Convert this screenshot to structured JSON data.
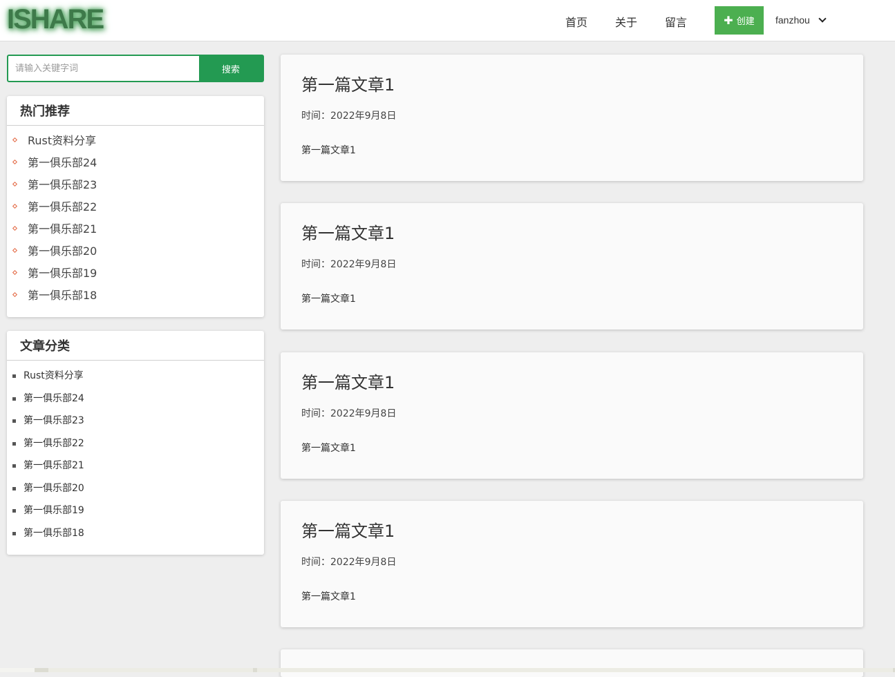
{
  "header": {
    "logo": "ISHARE",
    "nav": [
      "首页",
      "关于",
      "留言"
    ],
    "create_label": "创建",
    "username": "fanzhou"
  },
  "search": {
    "placeholder": "请输入关键字词",
    "button_label": "搜索"
  },
  "hot": {
    "title": "热门推荐",
    "items": [
      "Rust资料分享",
      "第一俱乐部24",
      "第一俱乐部23",
      "第一俱乐部22",
      "第一俱乐部21",
      "第一俱乐部20",
      "第一俱乐部19",
      "第一俱乐部18"
    ]
  },
  "categories": {
    "title": "文章分类",
    "items": [
      "Rust资料分享",
      "第一俱乐部24",
      "第一俱乐部23",
      "第一俱乐部22",
      "第一俱乐部21",
      "第一俱乐部20",
      "第一俱乐部19",
      "第一俱乐部18"
    ]
  },
  "articles": [
    {
      "title": "第一篇文章1",
      "time": "时间：2022年9月8日",
      "summary": "第一篇文章1"
    },
    {
      "title": "第一篇文章1",
      "time": "时间：2022年9月8日",
      "summary": "第一篇文章1"
    },
    {
      "title": "第一篇文章1",
      "time": "时间：2022年9月8日",
      "summary": "第一篇文章1"
    },
    {
      "title": "第一篇文章1",
      "time": "时间：2022年9月8日",
      "summary": "第一篇文章1"
    }
  ],
  "colors": {
    "brand_green": "#239a52",
    "create_green": "#4caf50",
    "bullet_orange": "#e2623b"
  }
}
